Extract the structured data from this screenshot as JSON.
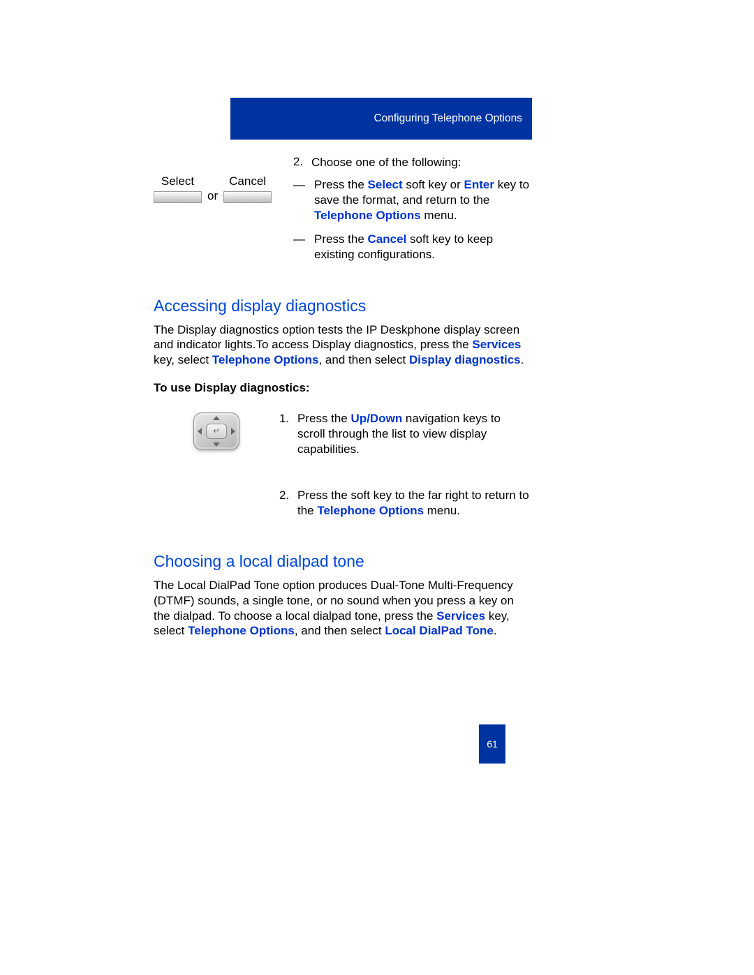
{
  "header": {
    "title": "Configuring Telephone Options"
  },
  "softkeys": {
    "select": "Select",
    "cancel": "Cancel",
    "or": "or"
  },
  "step2": {
    "num": "2.",
    "text": "Choose one of the following:",
    "bullets": [
      {
        "pre": "Press the ",
        "b1": "Select",
        "mid1": " soft key or ",
        "b2": "Enter",
        "mid2": " key to save the format, and return to the ",
        "b3": "Telephone Options",
        "post": " menu."
      },
      {
        "pre": "Press the ",
        "b1": "Cancel",
        "post": " soft key to keep existing configurations."
      }
    ]
  },
  "section1": {
    "heading": "Accessing display diagnostics",
    "p1a": "The Display diagnostics option tests the IP Deskphone display screen and indicator lights.To access Display diagnostics, press the ",
    "p1b": "Services",
    "p1c": " key, select ",
    "p1d": "Telephone Options",
    "p1e": ", and then select ",
    "p1f": "Display diagnostics",
    "p1g": ".",
    "sub": "To use Display diagnostics:",
    "step1": {
      "num": "1.",
      "pre": "Press the ",
      "b": "Up/Down",
      "post": " navigation keys to scroll through the list to view display capabilities."
    },
    "step2": {
      "num": "2.",
      "pre": "Press the soft key to the far right to return to the ",
      "b": "Telephone Options",
      "post": " menu."
    }
  },
  "section2": {
    "heading": "Choosing a local dialpad tone",
    "pa": "The Local DialPad Tone option produces Dual-Tone Multi-Frequency (DTMF) sounds, a single tone, or no sound when you press a key on the dialpad. To choose a local dialpad tone, press the ",
    "pb": "Services",
    "pc": " key, select ",
    "pd": "Telephone Options",
    "pe": ", and then select ",
    "pf": "Local DialPad Tone",
    "pg": "."
  },
  "pageNumber": "61"
}
